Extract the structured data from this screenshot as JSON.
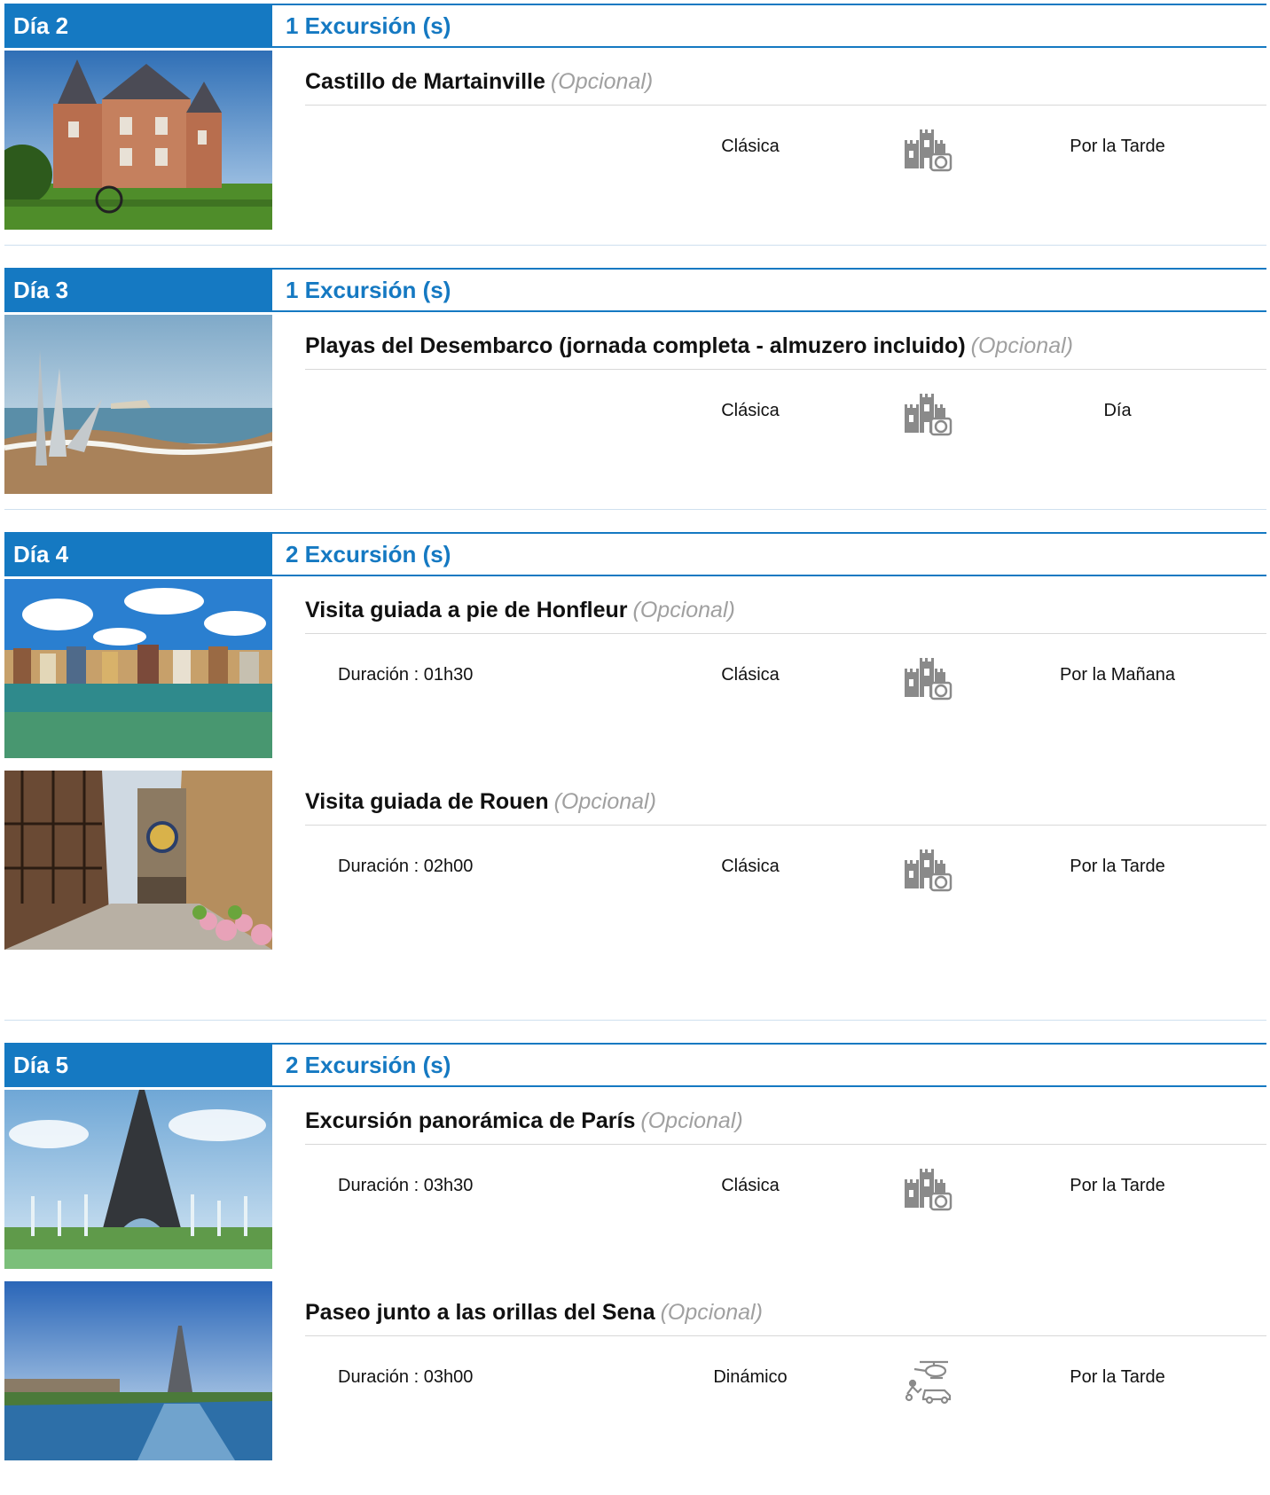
{
  "days": [
    {
      "label": "Día 2",
      "count": "1 Excursión (s)",
      "excursions": [
        {
          "title": "Castillo de Martainville",
          "optional": "(Opcional)",
          "duration": "",
          "style": "Clásica",
          "icon": "castle-camera-icon",
          "time": "Por la Tarde",
          "image": "castle"
        }
      ]
    },
    {
      "label": "Día 3",
      "count": "1 Excursión (s)",
      "excursions": [
        {
          "title": "Playas del Desembarco (jornada completa - almuzero incluido)",
          "optional": "(Opcional)",
          "duration": "",
          "style": "Clásica",
          "icon": "castle-camera-icon",
          "time": "Día",
          "image": "beach"
        }
      ]
    },
    {
      "label": "Día 4",
      "count": "2 Excursión (s)",
      "excursions": [
        {
          "title": "Visita guiada a pie de Honfleur",
          "optional": "(Opcional)",
          "duration": "Duración : 01h30",
          "style": "Clásica",
          "icon": "castle-camera-icon",
          "time": "Por la Mañana",
          "image": "harbor"
        },
        {
          "title": "Visita guiada de Rouen",
          "optional": "(Opcional)",
          "duration": "Duración : 02h00",
          "style": "Clásica",
          "icon": "castle-camera-icon",
          "time": "Por la Tarde",
          "image": "street"
        }
      ]
    },
    {
      "label": "Día 5",
      "count": "2 Excursión (s)",
      "excursions": [
        {
          "title": "Excursión panorámica de París",
          "optional": "(Opcional)",
          "duration": "Duración : 03h30",
          "style": "Clásica",
          "icon": "castle-camera-icon",
          "time": "Por la Tarde",
          "image": "eiffel"
        },
        {
          "title": "Paseo junto a las orillas del Sena",
          "optional": "(Opcional)",
          "duration": "Duración : 03h00",
          "style": "Dinámico",
          "icon": "helicopter-car-icon",
          "time": "Por la Tarde",
          "image": "seine"
        }
      ]
    }
  ],
  "colors": {
    "accent": "#1579c2",
    "optional": "#a0a0a0",
    "rule": "#d8d8d8",
    "separator": "#cfe0ef"
  }
}
